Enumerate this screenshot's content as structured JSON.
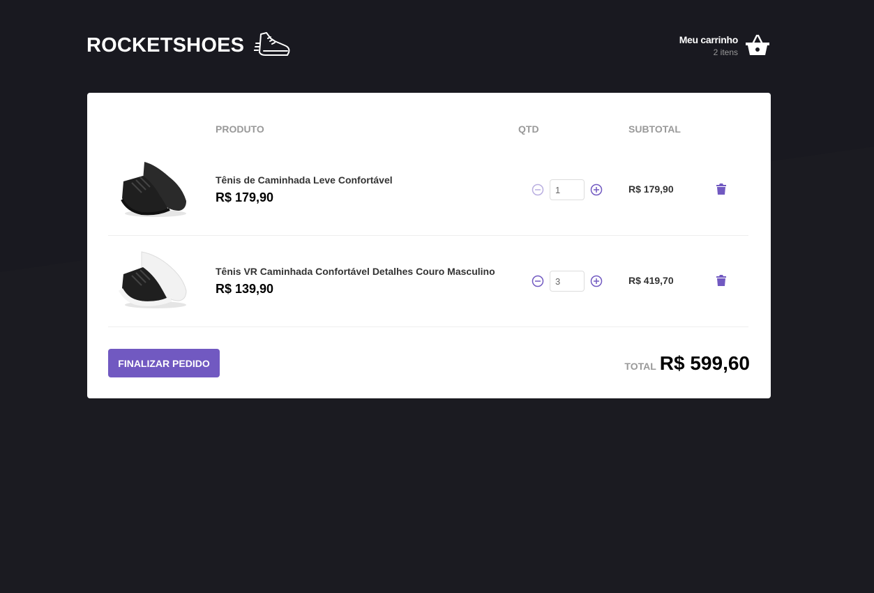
{
  "header": {
    "logo_text": "ROCKETSHOES",
    "logo_icon": "running-shoe-icon",
    "cart_title": "Meu carrinho",
    "cart_count": "2 itens",
    "cart_icon": "shopping-basket-icon"
  },
  "table": {
    "headers": {
      "image": "",
      "product": "PRODUTO",
      "qty": "QTD",
      "subtotal": "SUBTOTAL"
    },
    "rows": [
      {
        "name": "Tênis de Caminhada Leve Confortável",
        "price": "R$ 179,90",
        "quantity": "1",
        "subtotal": "R$ 179,90",
        "image_icon": "black-sneaker-image"
      },
      {
        "name": "Tênis VR Caminhada Confortável Detalhes Couro Masculino",
        "price": "R$ 139,90",
        "quantity": "3",
        "subtotal": "R$ 419,70",
        "image_icon": "black-white-sneaker-image"
      }
    ]
  },
  "footer": {
    "finish_label": "FINALIZAR PEDIDO",
    "total_label": "TOTAL",
    "total_value": "R$ 599,60"
  },
  "colors": {
    "background": "#191920",
    "accent": "#7159c1",
    "panel": "#ffffff"
  }
}
